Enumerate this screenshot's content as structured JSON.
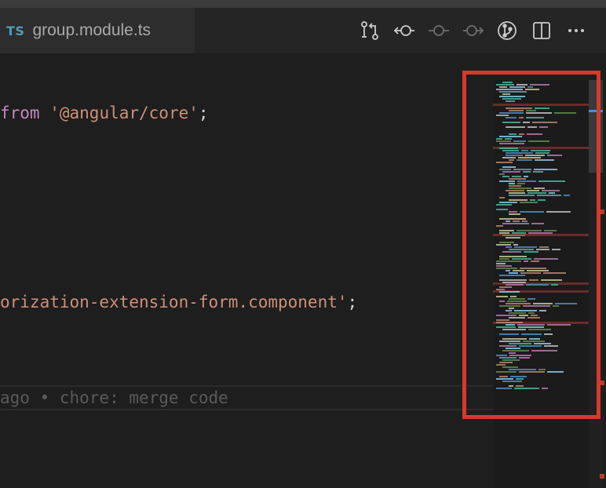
{
  "tab": {
    "lang_badge": "TS",
    "title": "group.module.ts"
  },
  "toolbar": {
    "actions": [
      {
        "name": "compare-changes-icon"
      },
      {
        "name": "previous-change-icon"
      },
      {
        "name": "current-commit-icon"
      },
      {
        "name": "next-change-icon"
      },
      {
        "name": "git-graph-icon"
      },
      {
        "name": "split-editor-icon"
      },
      {
        "name": "more-actions-icon"
      }
    ]
  },
  "editor": {
    "line1": {
      "kw": "from",
      "str": "'@angular/core'",
      "punct": ";"
    },
    "line2": {
      "str": "orization-extension-form.component'",
      "punct": ";"
    },
    "blame": "ago • chore: merge code"
  },
  "colors": {
    "annotation": "#d63a2c",
    "keyword": "#c586c0",
    "string": "#ce9178"
  }
}
